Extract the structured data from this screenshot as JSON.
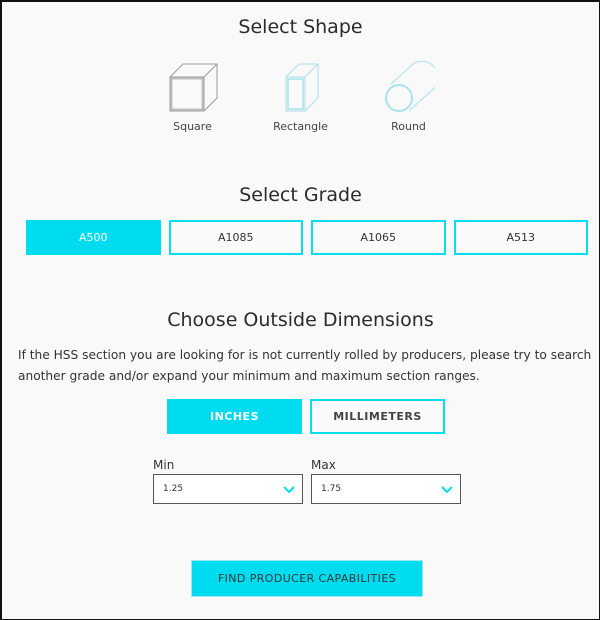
{
  "shape_section": {
    "title": "Select Shape",
    "shapes": [
      {
        "label": "Square",
        "icon": "square-tube-icon",
        "selected": true
      },
      {
        "label": "Rectangle",
        "icon": "rectangle-tube-icon",
        "selected": false
      },
      {
        "label": "Round",
        "icon": "round-tube-icon",
        "selected": false
      }
    ]
  },
  "grade_section": {
    "title": "Select Grade",
    "grades": [
      {
        "label": "A500",
        "active": true
      },
      {
        "label": "A1085",
        "active": false
      },
      {
        "label": "A1065",
        "active": false
      },
      {
        "label": "A513",
        "active": false
      }
    ]
  },
  "dimension_section": {
    "title": "Choose Outside Dimensions",
    "description": "If the HSS section you are looking for is not currently rolled by producers, please try to search another grade and/or expand your minimum and maximum section ranges.",
    "units": [
      {
        "label": "INCHES",
        "active": true
      },
      {
        "label": "MILLIMETERS",
        "active": false
      }
    ],
    "min": {
      "label": "Min",
      "value": "1.25"
    },
    "max": {
      "label": "Max",
      "value": "1.75"
    }
  },
  "submit": {
    "label": "FIND PRODUCER CAPABILITIES"
  },
  "colors": {
    "accent": "#00dcef",
    "text": "#333333",
    "background": "#f9f9f9"
  }
}
